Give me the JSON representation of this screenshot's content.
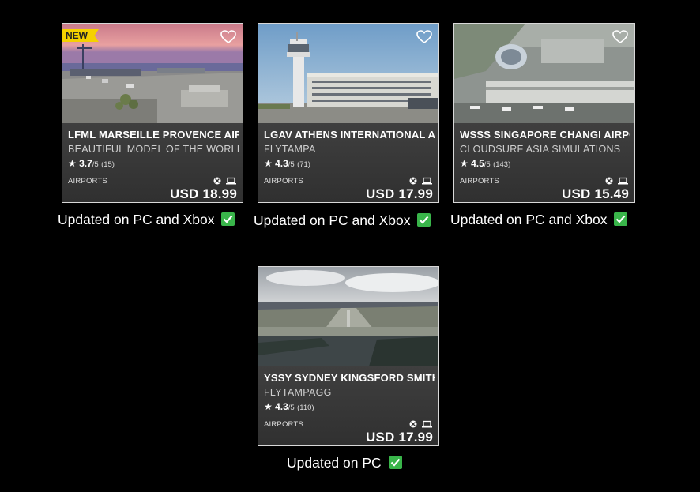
{
  "cards": [
    {
      "badge": "NEW",
      "title": "LFML MARSEILLE PROVENCE AIRP",
      "publisher": "BEAUTIFUL MODEL OF THE WORLD",
      "rating": "3.7",
      "rating_suffix": "/5",
      "rating_count": "(15)",
      "category": "AIRPORTS",
      "price": "USD 18.99",
      "caption": "Updated on PC and Xbox"
    },
    {
      "title": "LGAV ATHENS INTERNATIONAL AI",
      "publisher": "FLYTAMPA",
      "rating": "4.3",
      "rating_suffix": "/5",
      "rating_count": "(71)",
      "category": "AIRPORTS",
      "price": "USD 17.99",
      "caption": "Updated on PC and Xbox"
    },
    {
      "title": "WSSS SINGAPORE CHANGI AIRPOI",
      "publisher": "CLOUDSURF ASIA SIMULATIONS",
      "rating": "4.5",
      "rating_suffix": "/5",
      "rating_count": "(143)",
      "category": "AIRPORTS",
      "price": "USD 15.49",
      "caption": "Updated on PC and Xbox"
    },
    {
      "title": "YSSY SYDNEY KINGSFORD SMITH",
      "publisher": "FLYTAMPAGG",
      "rating": "4.3",
      "rating_suffix": "/5",
      "rating_count": "(110)",
      "category": "AIRPORTS",
      "price": "USD 17.99",
      "caption": "Updated on PC"
    }
  ],
  "icons": {
    "favorite": "heart-outline-icon",
    "rating": "star-icon",
    "platform_xbox": "xbox-icon",
    "platform_pc": "laptop-icon",
    "updated": "green-check-icon"
  },
  "colors": {
    "background": "#000000",
    "badge": "#f5d100",
    "check": "#39b54a"
  }
}
